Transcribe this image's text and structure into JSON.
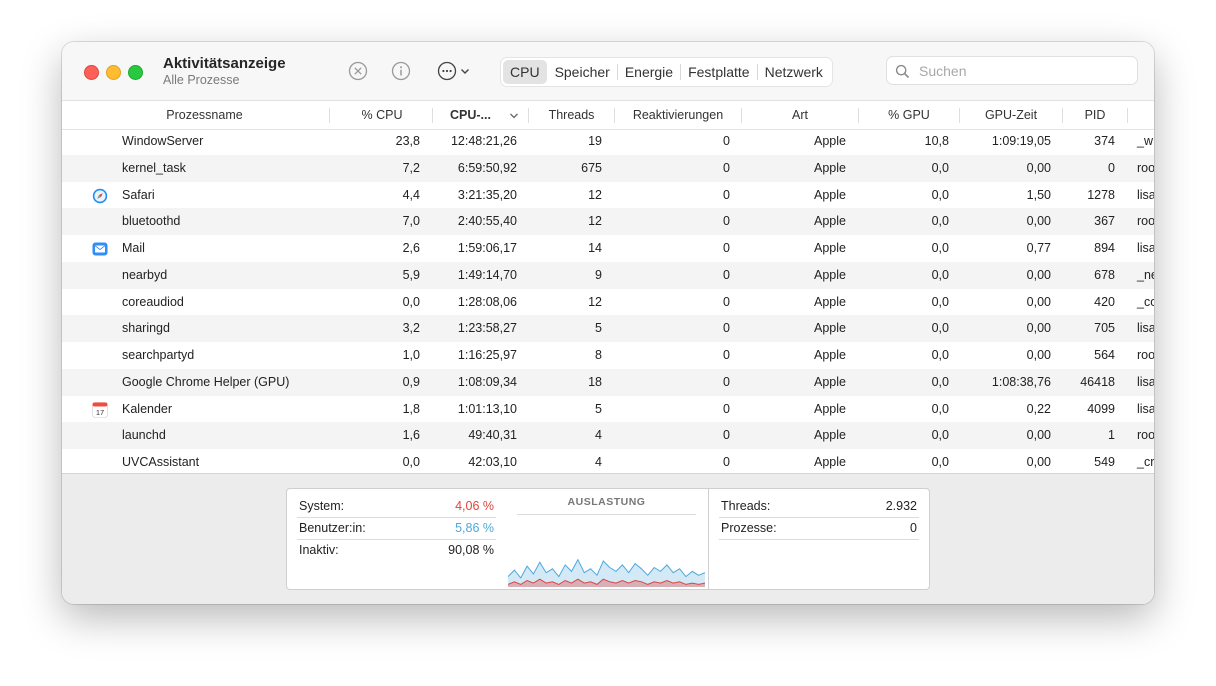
{
  "window": {
    "title": "Aktivitätsanzeige",
    "subtitle": "Alle Prozesse"
  },
  "toolbar": {
    "tabs": [
      "CPU",
      "Speicher",
      "Energie",
      "Festplatte",
      "Netzwerk"
    ],
    "active_tab": "CPU",
    "search_placeholder": "Suchen",
    "icons": [
      "stop-process-icon",
      "info-icon",
      "more-actions-icon",
      "chevron-down-icon",
      "search-icon"
    ]
  },
  "table": {
    "columns": [
      "Prozessname",
      "% CPU",
      "CPU-...",
      "Threads",
      "Reaktivierungen",
      "Art",
      "% GPU",
      "GPU-Zeit",
      "PID"
    ],
    "sorted_column": "CPU-...",
    "rows": [
      {
        "name": "WindowServer",
        "cpu": "23,8",
        "cputime": "12:48:21,26",
        "threads": "19",
        "wakeups": "0",
        "kind": "Apple",
        "gpu": "10,8",
        "gputime": "1:09:19,05",
        "pid": "374",
        "user": "_w",
        "icon": ""
      },
      {
        "name": "kernel_task",
        "cpu": "7,2",
        "cputime": "6:59:50,92",
        "threads": "675",
        "wakeups": "0",
        "kind": "Apple",
        "gpu": "0,0",
        "gputime": "0,00",
        "pid": "0",
        "user": "roo",
        "icon": ""
      },
      {
        "name": "Safari",
        "cpu": "4,4",
        "cputime": "3:21:35,20",
        "threads": "12",
        "wakeups": "0",
        "kind": "Apple",
        "gpu": "0,0",
        "gputime": "1,50",
        "pid": "1278",
        "user": "lisa",
        "icon": "safari-icon"
      },
      {
        "name": "bluetoothd",
        "cpu": "7,0",
        "cputime": "2:40:55,40",
        "threads": "12",
        "wakeups": "0",
        "kind": "Apple",
        "gpu": "0,0",
        "gputime": "0,00",
        "pid": "367",
        "user": "roo",
        "icon": ""
      },
      {
        "name": "Mail",
        "cpu": "2,6",
        "cputime": "1:59:06,17",
        "threads": "14",
        "wakeups": "0",
        "kind": "Apple",
        "gpu": "0,0",
        "gputime": "0,77",
        "pid": "894",
        "user": "lisa",
        "icon": "mail-icon"
      },
      {
        "name": "nearbyd",
        "cpu": "5,9",
        "cputime": "1:49:14,70",
        "threads": "9",
        "wakeups": "0",
        "kind": "Apple",
        "gpu": "0,0",
        "gputime": "0,00",
        "pid": "678",
        "user": "_ne",
        "icon": ""
      },
      {
        "name": "coreaudiod",
        "cpu": "0,0",
        "cputime": "1:28:08,06",
        "threads": "12",
        "wakeups": "0",
        "kind": "Apple",
        "gpu": "0,0",
        "gputime": "0,00",
        "pid": "420",
        "user": "_co",
        "icon": ""
      },
      {
        "name": "sharingd",
        "cpu": "3,2",
        "cputime": "1:23:58,27",
        "threads": "5",
        "wakeups": "0",
        "kind": "Apple",
        "gpu": "0,0",
        "gputime": "0,00",
        "pid": "705",
        "user": "lisa",
        "icon": ""
      },
      {
        "name": "searchpartyd",
        "cpu": "1,0",
        "cputime": "1:16:25,97",
        "threads": "8",
        "wakeups": "0",
        "kind": "Apple",
        "gpu": "0,0",
        "gputime": "0,00",
        "pid": "564",
        "user": "roo",
        "icon": ""
      },
      {
        "name": "Google Chrome Helper (GPU)",
        "cpu": "0,9",
        "cputime": "1:08:09,34",
        "threads": "18",
        "wakeups": "0",
        "kind": "Apple",
        "gpu": "0,0",
        "gputime": "1:08:38,76",
        "pid": "46418",
        "user": "lisa",
        "icon": ""
      },
      {
        "name": "Kalender",
        "cpu": "1,8",
        "cputime": "1:01:13,10",
        "threads": "5",
        "wakeups": "0",
        "kind": "Apple",
        "gpu": "0,0",
        "gputime": "0,22",
        "pid": "4099",
        "user": "lisa",
        "icon": "calendar-icon"
      },
      {
        "name": "launchd",
        "cpu": "1,6",
        "cputime": "49:40,31",
        "threads": "4",
        "wakeups": "0",
        "kind": "Apple",
        "gpu": "0,0",
        "gputime": "0,00",
        "pid": "1",
        "user": "roo",
        "icon": ""
      },
      {
        "name": "UVCAssistant",
        "cpu": "0,0",
        "cputime": "42:03,10",
        "threads": "4",
        "wakeups": "0",
        "kind": "Apple",
        "gpu": "0,0",
        "gputime": "0,00",
        "pid": "549",
        "user": "_cr",
        "icon": ""
      }
    ]
  },
  "stats": {
    "system_label": "System:",
    "system_value": "4,06 %",
    "user_label": "Benutzer:in:",
    "user_value": "5,86 %",
    "idle_label": "Inaktiv:",
    "idle_value": "90,08 %",
    "graph_title": "AUSLASTUNG",
    "threads_label": "Threads:",
    "threads_value": "2.932",
    "processes_label": "Prozesse:",
    "processes_value": "0"
  },
  "colors": {
    "system": "#e0443e",
    "user": "#4ea8dc"
  },
  "load_history": {
    "user": [
      6,
      9,
      5,
      11,
      7,
      13,
      8,
      10,
      6,
      12,
      9,
      15,
      8,
      10,
      7,
      14,
      11,
      9,
      12,
      8,
      13,
      10,
      7,
      11,
      9,
      12,
      8,
      10,
      6,
      9,
      7,
      8
    ],
    "system": [
      2,
      4,
      2,
      5,
      3,
      6,
      3,
      4,
      2,
      5,
      3,
      6,
      3,
      4,
      2,
      6,
      4,
      3,
      5,
      3,
      5,
      4,
      2,
      4,
      3,
      5,
      3,
      4,
      2,
      3,
      2,
      3
    ]
  }
}
